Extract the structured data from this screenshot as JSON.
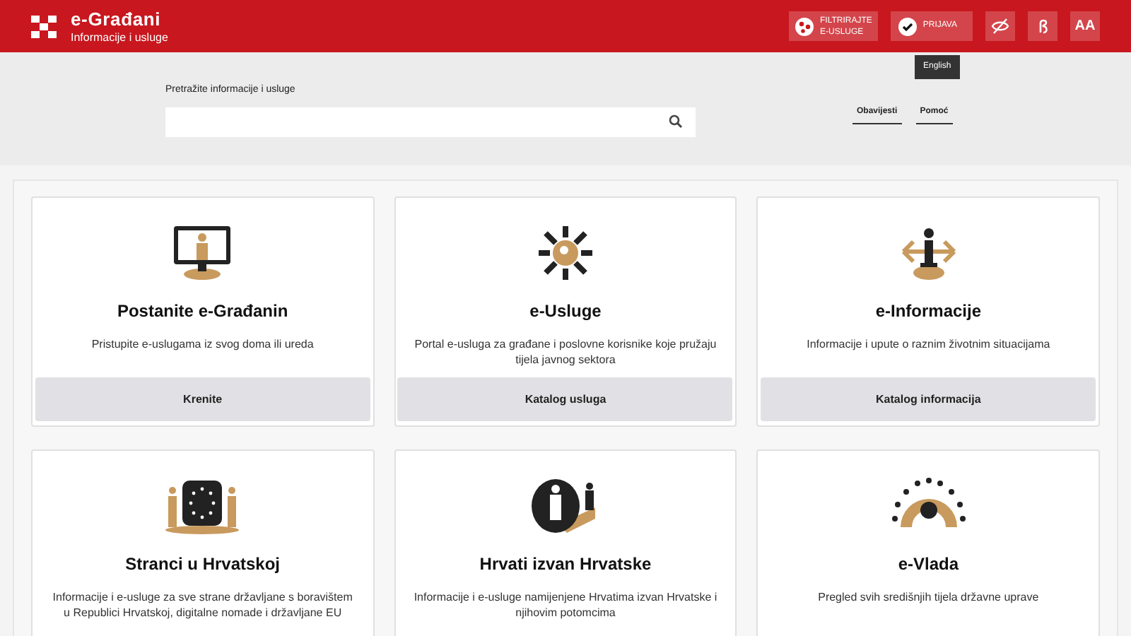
{
  "header": {
    "logo_title": "e-Građani",
    "logo_subtitle": "Informacije i usluge",
    "filter_button": [
      "FILTRIRAJTE",
      "E-USLUGE"
    ],
    "login_button": "PRIJAVA",
    "text_size_button": "AA",
    "tooltip": "English"
  },
  "search": {
    "label": "Pretražite informacije i usluge"
  },
  "nav_links": [
    "Obavijesti",
    "Pomoć"
  ],
  "cards": [
    {
      "title": "Postanite e-Građanin",
      "description": "Pristupite e-uslugama iz svog doma ili ureda",
      "button": "Krenite"
    },
    {
      "title": "e-Usluge",
      "description": "Portal e-usluga za građane i poslovne korisnike koje pružaju tijela javnog sektora",
      "button": "Katalog usluga"
    },
    {
      "title": "e-Informacije",
      "description": "Informacije i upute o raznim životnim situacijama",
      "button": "Katalog informacija"
    },
    {
      "title": "Stranci u Hrvatskoj",
      "description": "Informacije i e-usluge za sve strane državljane s boravištem u Republici Hrvatskoj, digitalne nomade i državljane EU"
    },
    {
      "title": "Hrvati izvan Hrvatske",
      "description": "Informacije i e-usluge namijenjene Hrvatima izvan Hrvatske i njihovim potomcima"
    },
    {
      "title": "e-Vlada",
      "description": "Pregled svih središnjih tijela državne uprave"
    }
  ]
}
